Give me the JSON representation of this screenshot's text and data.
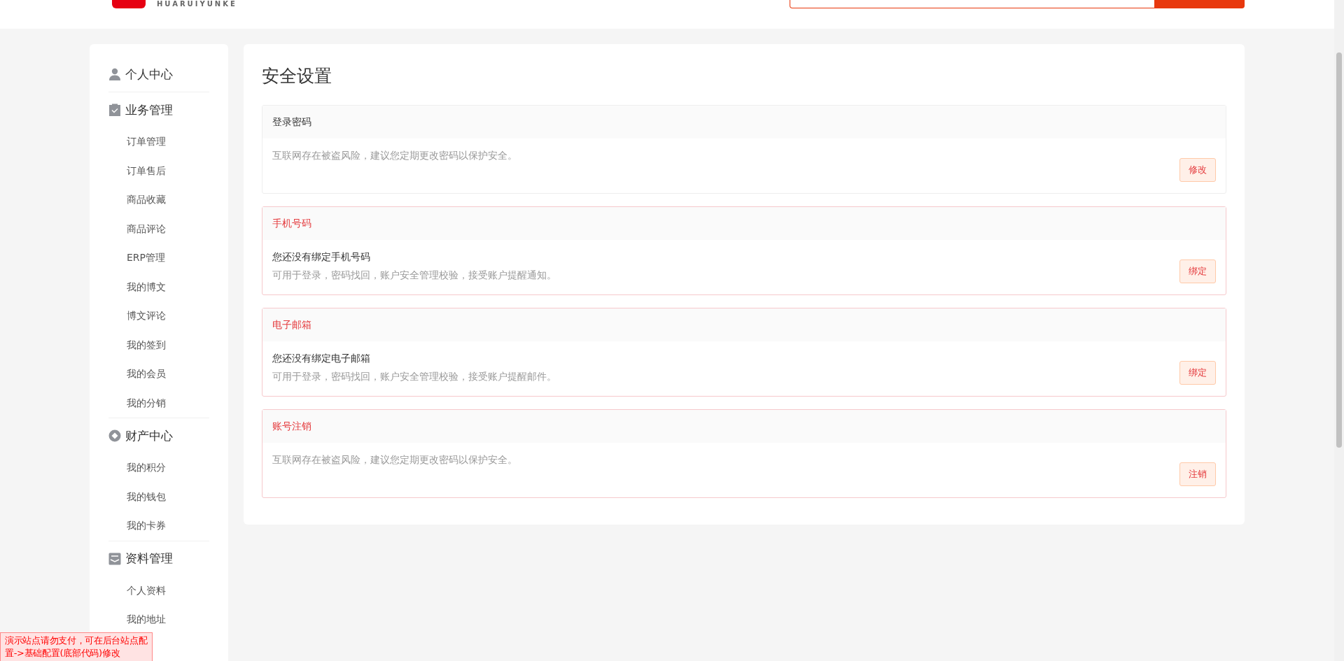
{
  "header": {
    "logo_text": "HUARUIYUNKE"
  },
  "sidebar": {
    "groups": [
      {
        "title": "个人中心"
      },
      {
        "title": "业务管理",
        "items": [
          "订单管理",
          "订单售后",
          "商品收藏",
          "商品评论",
          "ERP管理",
          "我的博文",
          "博文评论",
          "我的签到",
          "我的会员",
          "我的分销"
        ]
      },
      {
        "title": "财产中心",
        "items": [
          "我的积分",
          "我的钱包",
          "我的卡券"
        ]
      },
      {
        "title": "资料管理",
        "items": [
          "个人资料",
          "我的地址"
        ]
      }
    ]
  },
  "page_title": "安全设置",
  "sections": [
    {
      "title": "登录密码",
      "warning": false,
      "description": "互联网存在被盗风险，建议您定期更改密码以保护安全。",
      "button": "修改"
    },
    {
      "title": "手机号码",
      "warning": true,
      "status": "您还没有绑定手机号码",
      "description": "可用于登录，密码找回，账户安全管理校验，接受账户提醒通知。",
      "button": "绑定"
    },
    {
      "title": "电子邮箱",
      "warning": true,
      "status": "您还没有绑定电子邮箱",
      "description": "可用于登录，密码找回，账户安全管理校验，接受账户提醒邮件。",
      "button": "绑定"
    },
    {
      "title": "账号注销",
      "warning": true,
      "description": "互联网存在被盗风险，建议您定期更改密码以保护安全。",
      "button": "注销"
    }
  ],
  "notice": "演示站点请勿支付，可在后台站点配置->基础配置(底部代码)修改"
}
